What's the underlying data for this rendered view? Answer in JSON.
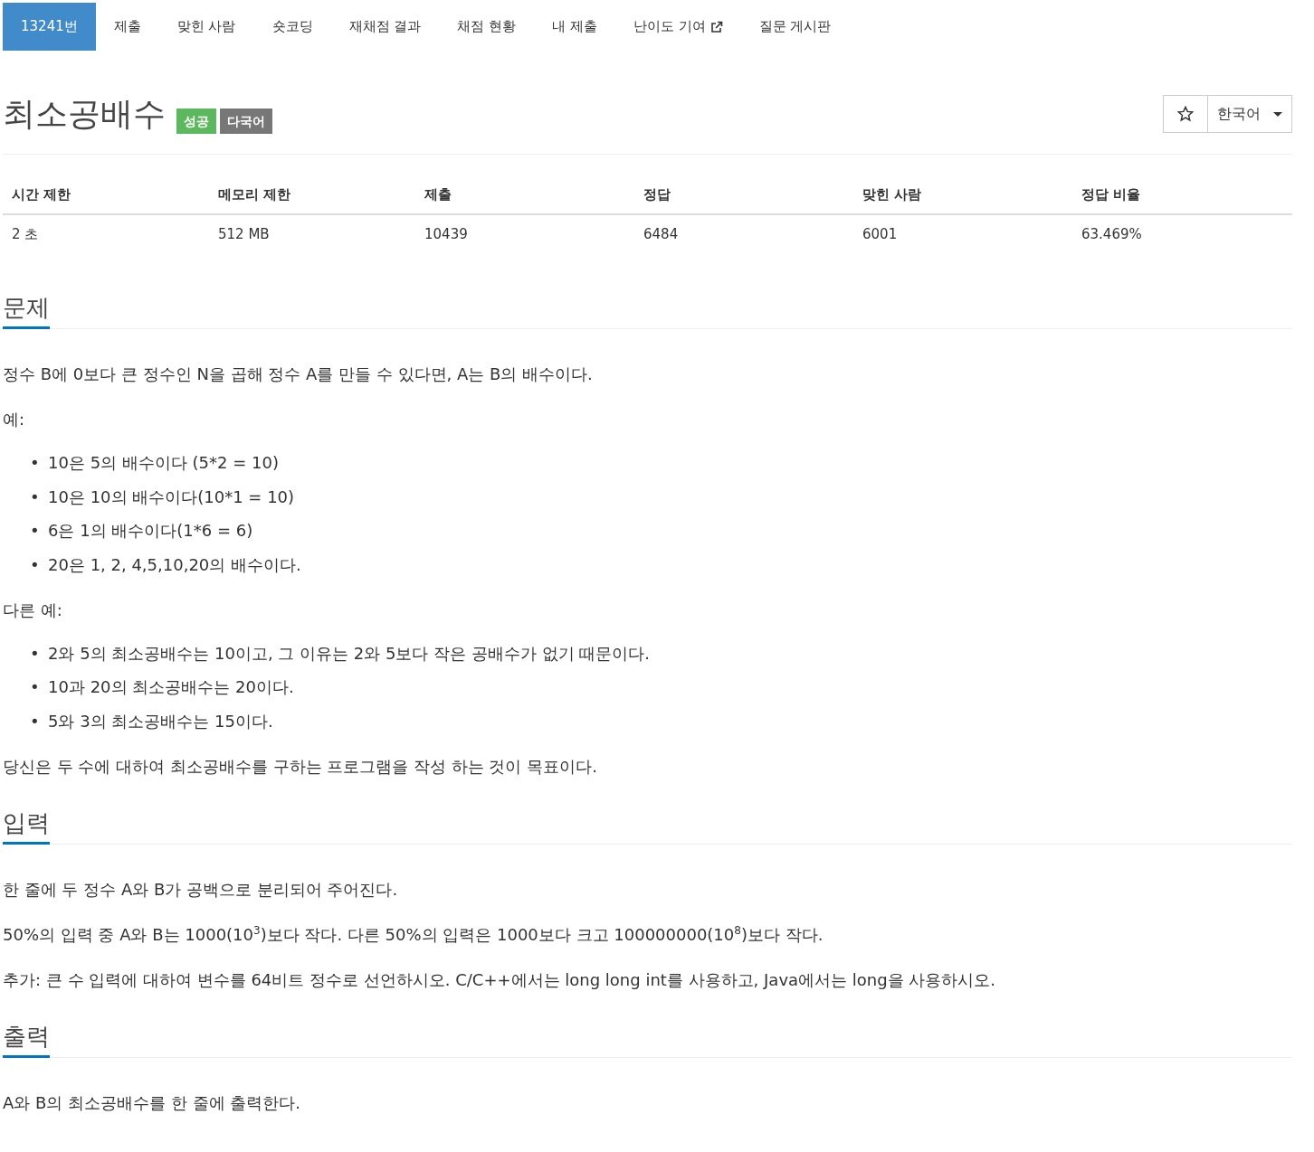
{
  "tabs": [
    {
      "label": "13241번",
      "selected": true,
      "external": false
    },
    {
      "label": "제출",
      "selected": false,
      "external": false
    },
    {
      "label": "맞힌 사람",
      "selected": false,
      "external": false
    },
    {
      "label": "숏코딩",
      "selected": false,
      "external": false
    },
    {
      "label": "재채점 결과",
      "selected": false,
      "external": false
    },
    {
      "label": "채점 현황",
      "selected": false,
      "external": false
    },
    {
      "label": "내 제출",
      "selected": false,
      "external": false
    },
    {
      "label": "난이도 기여",
      "selected": false,
      "external": true
    },
    {
      "label": "질문 게시판",
      "selected": false,
      "external": false
    }
  ],
  "problem": {
    "title": "최소공배수",
    "badges": [
      {
        "label": "성공",
        "color": "#5cb85c"
      },
      {
        "label": "다국어",
        "color": "#777777"
      }
    ],
    "language": "한국어"
  },
  "stats": {
    "columns": [
      "시간 제한",
      "메모리 제한",
      "제출",
      "정답",
      "맞힌 사람",
      "정답 비율"
    ],
    "rows": [
      [
        "2 초",
        "512 MB",
        "10439",
        "6484",
        "6001",
        "63.469%"
      ]
    ]
  },
  "sections": [
    {
      "title": "문제",
      "blocks": [
        {
          "kind": "paragraph",
          "text": "정수 B에 0보다 큰 정수인 N을 곱해 정수 A를 만들 수 있다면, A는 B의 배수이다."
        },
        {
          "kind": "paragraph",
          "text": "예:"
        },
        {
          "kind": "list",
          "marker": "•",
          "items": [
            "10은 5의 배수이다 (5*2 = 10)",
            "10은 10의 배수이다(10*1 = 10)",
            "6은 1의 배수이다(1*6 = 6)",
            "20은 1, 2, 4,5,10,20의 배수이다."
          ]
        },
        {
          "kind": "paragraph",
          "text": "다른 예:"
        },
        {
          "kind": "list",
          "marker": "•",
          "items": [
            "2와 5의 최소공배수는 10이고, 그 이유는 2와 5보다 작은 공배수가 없기 때문이다.",
            "10과 20의 최소공배수는 20이다.",
            "5와 3의 최소공배수는 15이다."
          ]
        },
        {
          "kind": "paragraph",
          "text": "당신은 두 수에 대하여 최소공배수를 구하는 프로그램을 작성 하는 것이 목표이다."
        }
      ]
    },
    {
      "title": "입력",
      "blocks": [
        {
          "kind": "paragraph",
          "text": "한 줄에 두 정수 A와 B가 공백으로 분리되어 주어진다."
        },
        {
          "kind": "paragraph",
          "text": "50%의 입력 중 A와 B는 1000(10$^{3}$)보다 작다. 다른 50%의 입력은 1000보다 크고 100000000(10$^{8}$)보다 작다."
        },
        {
          "kind": "paragraph",
          "text": "추가: 큰 수 입력에 대하여 변수를 64비트 정수로 선언하시오. C/C++에서는 long long int를 사용하고, Java에서는 long을 사용하시오."
        }
      ]
    },
    {
      "title": "출력",
      "blocks": [
        {
          "kind": "paragraph",
          "text": "A와 B의 최소공배수를 한 줄에 출력한다."
        }
      ]
    }
  ]
}
